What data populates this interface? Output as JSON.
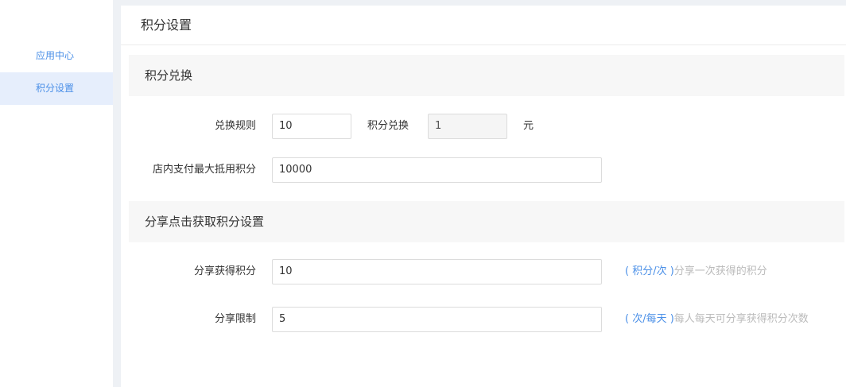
{
  "sidebar": {
    "items": [
      {
        "label": "应用中心",
        "active": false
      },
      {
        "label": "积分设置",
        "active": true
      }
    ]
  },
  "page": {
    "title": "积分设置"
  },
  "exchange": {
    "section_title": "积分兑换",
    "rule_label": "兑换规则",
    "rule_value": "10",
    "points_exchange_label": "积分兑换",
    "points_exchange_value": "1",
    "currency_unit": "元",
    "max_deduct_label": "店内支付最大抵用积分",
    "max_deduct_value": "10000"
  },
  "share": {
    "section_title": "分享点击获取积分设置",
    "points_label": "分享获得积分",
    "points_value": "10",
    "points_unit": "( 积分/次 )",
    "points_desc": "分享一次获得的积分",
    "limit_label": "分享限制",
    "limit_value": "5",
    "limit_unit": "( 次/每天 )",
    "limit_desc": "每人每天可分享获得积分次数"
  },
  "colors": {
    "accent": "#4a8fe7",
    "hint": "#bbbbbb",
    "active_bg": "#e6eefc"
  }
}
